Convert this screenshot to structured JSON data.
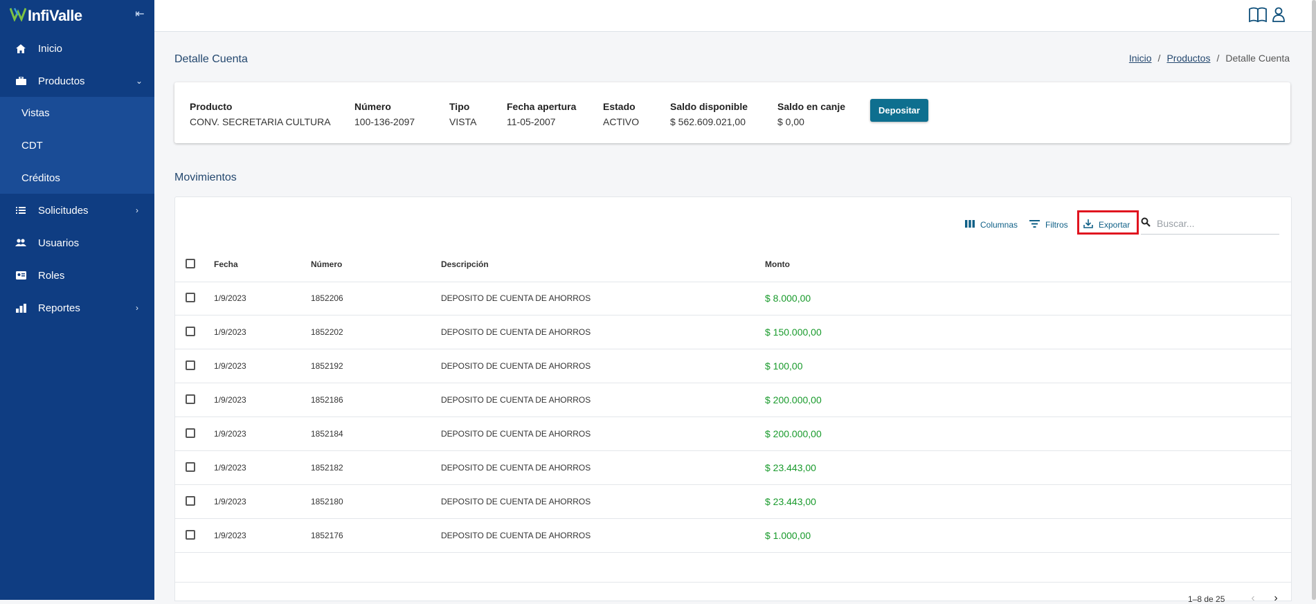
{
  "app": {
    "name": "InfiValle"
  },
  "sidebar": {
    "items": [
      {
        "label": "Inicio",
        "icon": "home-icon"
      },
      {
        "label": "Productos",
        "icon": "briefcase-icon",
        "expanded": true,
        "children": [
          {
            "label": "Vistas"
          },
          {
            "label": "CDT"
          },
          {
            "label": "Créditos"
          }
        ]
      },
      {
        "label": "Solicitudes",
        "icon": "list-icon"
      },
      {
        "label": "Usuarios",
        "icon": "users-icon"
      },
      {
        "label": "Roles",
        "icon": "id-card-icon"
      },
      {
        "label": "Reportes",
        "icon": "bar-chart-icon"
      }
    ]
  },
  "header": {
    "title": "Detalle Cuenta",
    "breadcrumb": [
      "Inicio",
      "Productos",
      "Detalle Cuenta"
    ]
  },
  "account": {
    "fields": [
      {
        "label": "Producto",
        "value": "CONV. SECRETARIA CULTURA"
      },
      {
        "label": "Número",
        "value": "100-136-2097"
      },
      {
        "label": "Tipo",
        "value": "VISTA"
      },
      {
        "label": "Fecha apertura",
        "value": "11-05-2007"
      },
      {
        "label": "Estado",
        "value": "ACTIVO"
      },
      {
        "label": "Saldo disponible",
        "value": "$ 562.609.021,00"
      },
      {
        "label": "Saldo en canje",
        "value": "$ 0,00"
      }
    ],
    "deposit_label": "Depositar"
  },
  "movements": {
    "title": "Movimientos",
    "toolbar": {
      "columns_label": "Columnas",
      "filters_label": "Filtros",
      "export_label": "Exportar",
      "search_placeholder": "Buscar..."
    },
    "columns": [
      "Fecha",
      "Número",
      "Descripción",
      "Monto"
    ],
    "rows": [
      {
        "fecha": "1/9/2023",
        "numero": "1852206",
        "descripcion": "DEPOSITO DE CUENTA DE AHORROS",
        "monto": "$ 8.000,00"
      },
      {
        "fecha": "1/9/2023",
        "numero": "1852202",
        "descripcion": "DEPOSITO DE CUENTA DE AHORROS",
        "monto": "$ 150.000,00"
      },
      {
        "fecha": "1/9/2023",
        "numero": "1852192",
        "descripcion": "DEPOSITO DE CUENTA DE AHORROS",
        "monto": "$ 100,00"
      },
      {
        "fecha": "1/9/2023",
        "numero": "1852186",
        "descripcion": "DEPOSITO DE CUENTA DE AHORROS",
        "monto": "$ 200.000,00"
      },
      {
        "fecha": "1/9/2023",
        "numero": "1852184",
        "descripcion": "DEPOSITO DE CUENTA DE AHORROS",
        "monto": "$ 200.000,00"
      },
      {
        "fecha": "1/9/2023",
        "numero": "1852182",
        "descripcion": "DEPOSITO DE CUENTA DE AHORROS",
        "monto": "$ 23.443,00"
      },
      {
        "fecha": "1/9/2023",
        "numero": "1852180",
        "descripcion": "DEPOSITO DE CUENTA DE AHORROS",
        "monto": "$ 23.443,00"
      },
      {
        "fecha": "1/9/2023",
        "numero": "1852176",
        "descripcion": "DEPOSITO DE CUENTA DE AHORROS",
        "monto": "$ 1.000,00"
      }
    ],
    "pagination": "1–8 de 25"
  },
  "colors": {
    "sidebar": "#0f3d82",
    "submenu": "#1a4c96",
    "accent": "#0e6f8f",
    "amount": "#189a2b",
    "highlight": "#e0141f"
  }
}
